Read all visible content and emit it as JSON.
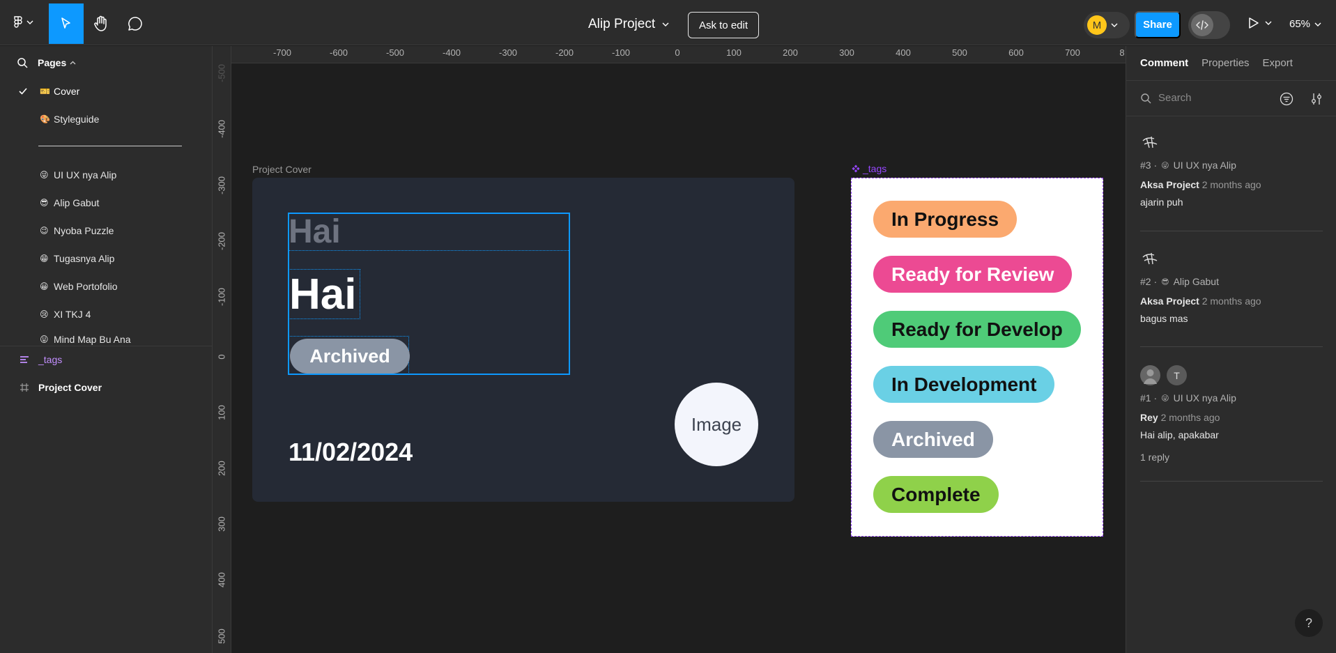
{
  "topbar": {
    "project_title": "Alip Project",
    "ask_to_edit": "Ask to edit",
    "avatar_initial": "M",
    "share": "Share",
    "zoom": "65%",
    "colors": {
      "accent": "#0d99ff",
      "avatar": "#ffc61a"
    }
  },
  "pages": {
    "header": "Pages",
    "items": [
      {
        "emoji": "🎫",
        "label": "Cover",
        "active": true
      },
      {
        "emoji": "🎨",
        "label": "Styleguide"
      },
      {
        "emoji": "😜",
        "label": "UI UX nya Alip"
      },
      {
        "emoji": "😎",
        "label": "Alip Gabut"
      },
      {
        "emoji": "😉",
        "label": "Nyoba Puzzle"
      },
      {
        "emoji": "😁",
        "label": "Tugasnya Alip"
      },
      {
        "emoji": "😀",
        "label": "Web Portofolio"
      },
      {
        "emoji": "😢",
        "label": "XI TKJ 4"
      },
      {
        "emoji": "😛",
        "label": "Mind Map Bu Ana"
      }
    ]
  },
  "layers": [
    {
      "icon": "component-icon",
      "label": "_tags"
    },
    {
      "icon": "frame-icon",
      "label": "Project Cover"
    }
  ],
  "rulers": {
    "x": [
      "-700",
      "-600",
      "-500",
      "-400",
      "-300",
      "-200",
      "-100",
      "0",
      "100",
      "200",
      "300",
      "400",
      "500",
      "600",
      "700",
      "8"
    ],
    "y": [
      "-500",
      "-400",
      "-300",
      "-200",
      "-100",
      "0",
      "100",
      "200",
      "300",
      "400",
      "500"
    ]
  },
  "canvas": {
    "cover_frame": {
      "label": "Project Cover",
      "heading_ghost": "Hai",
      "heading": "Hai",
      "badge": "Archived",
      "date": "11/02/2024",
      "image_placeholder": "Image"
    },
    "tags_frame": {
      "label": "_tags",
      "tags": [
        {
          "label": "In Progress",
          "color": "#fba96f"
        },
        {
          "label": "Ready for Review",
          "color": "#ec4a93"
        },
        {
          "label": "Ready for Develop",
          "color": "#4fcb78"
        },
        {
          "label": "In Development",
          "color": "#6ad0e5"
        },
        {
          "label": "Archived",
          "color": "#8a95a5"
        },
        {
          "label": "Complete",
          "color": "#8fd14a"
        }
      ]
    }
  },
  "right_panel": {
    "tabs": [
      "Comment",
      "Properties",
      "Export"
    ],
    "search_placeholder": "Search",
    "comments": [
      {
        "number": "#3 ·",
        "emoji": "😜",
        "page": "UI UX nya Alip",
        "author": "Aksa Project",
        "time": "2 months ago",
        "text": "ajarin puh"
      },
      {
        "number": "#2 ·",
        "emoji": "😎",
        "page": "Alip Gabut",
        "author": "Aksa Project",
        "time": "2 months ago",
        "text": "bagus mas"
      },
      {
        "number": "#1 ·",
        "emoji": "😜",
        "page": "UI UX nya Alip",
        "author": "Rey",
        "time": "2 months ago",
        "text": "Hai alip, apakabar",
        "reply": "1 reply",
        "second_avatar": "T"
      }
    ],
    "help": "?"
  }
}
